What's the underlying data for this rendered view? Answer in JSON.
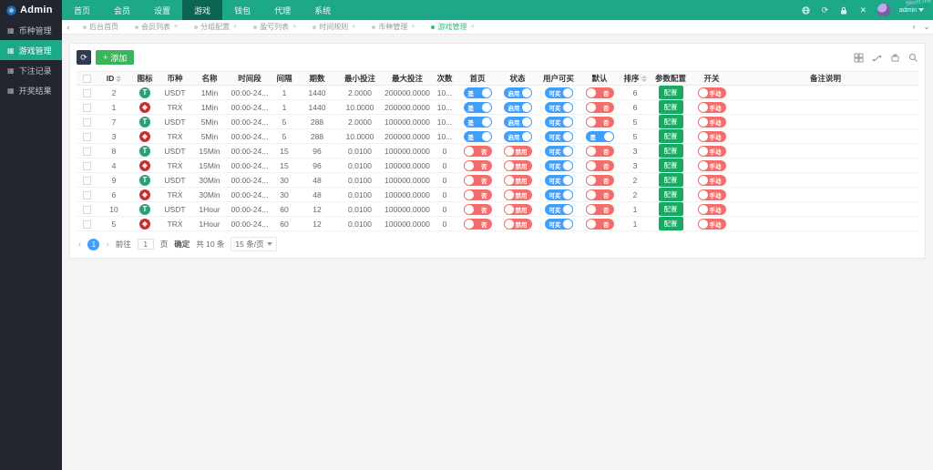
{
  "topbar": {
    "brand": "Admin",
    "nav": [
      {
        "label": "首页",
        "active": false
      },
      {
        "label": "会员",
        "active": false
      },
      {
        "label": "设置",
        "active": false
      },
      {
        "label": "游戏",
        "active": true
      },
      {
        "label": "钱包",
        "active": false
      },
      {
        "label": "代理",
        "active": false
      },
      {
        "label": "系统",
        "active": false
      }
    ],
    "icons": [
      "language-icon",
      "refresh-icon",
      "lock-icon",
      "fullscreen-icon"
    ],
    "user": "admin",
    "watermark": "9kvm.me"
  },
  "sidebar": {
    "items": [
      {
        "label": "币种管理",
        "active": false
      },
      {
        "label": "游戏管理",
        "active": true
      },
      {
        "label": "下注记录",
        "active": false
      },
      {
        "label": "开奖结果",
        "active": false
      }
    ]
  },
  "tabs": {
    "items": [
      {
        "label": "后台首页",
        "closable": false,
        "active": false
      },
      {
        "label": "会员列表",
        "closable": true,
        "active": false
      },
      {
        "label": "分组配置",
        "closable": true,
        "active": false
      },
      {
        "label": "盈亏列表",
        "closable": true,
        "active": false
      },
      {
        "label": "时间规则",
        "closable": true,
        "active": false
      },
      {
        "label": "币种管理",
        "closable": true,
        "active": false
      },
      {
        "label": "游戏管理",
        "closable": true,
        "active": true
      }
    ]
  },
  "toolbar": {
    "add_label": "添加"
  },
  "table": {
    "headers": [
      "ID",
      "图标",
      "币种",
      "名称",
      "时间段",
      "间隔",
      "期数",
      "最小投注",
      "最大投注",
      "次数",
      "首页",
      "状态",
      "用户可买",
      "默认",
      "排序",
      "参数配置",
      "开关",
      "备注说明"
    ],
    "config_label": "配置",
    "rows": [
      {
        "id": "2",
        "coin": "USDT",
        "name": "1Min",
        "time": "00:00-24...",
        "interval": "1",
        "periods": "1440",
        "min": "2.0000",
        "max": "200000.0000",
        "count": "10...",
        "home": {
          "on": true,
          "label": "是"
        },
        "status": {
          "on": true,
          "label": "启用"
        },
        "buyable": {
          "on": true,
          "label": "可买"
        },
        "dft": {
          "on": false,
          "label": "否"
        },
        "sort": "6",
        "switch": {
          "on": false,
          "label": "手动"
        }
      },
      {
        "id": "1",
        "coin": "TRX",
        "name": "1Min",
        "time": "00:00-24...",
        "interval": "1",
        "periods": "1440",
        "min": "10.0000",
        "max": "200000.0000",
        "count": "10...",
        "home": {
          "on": true,
          "label": "是"
        },
        "status": {
          "on": true,
          "label": "启用"
        },
        "buyable": {
          "on": true,
          "label": "可买"
        },
        "dft": {
          "on": false,
          "label": "否"
        },
        "sort": "6",
        "switch": {
          "on": false,
          "label": "手动"
        }
      },
      {
        "id": "7",
        "coin": "USDT",
        "name": "5Min",
        "time": "00:00-24...",
        "interval": "5",
        "periods": "288",
        "min": "2.0000",
        "max": "100000.0000",
        "count": "10...",
        "home": {
          "on": true,
          "label": "是"
        },
        "status": {
          "on": true,
          "label": "启用"
        },
        "buyable": {
          "on": true,
          "label": "可买"
        },
        "dft": {
          "on": false,
          "label": "否"
        },
        "sort": "5",
        "switch": {
          "on": false,
          "label": "手动"
        }
      },
      {
        "id": "3",
        "coin": "TRX",
        "name": "5Min",
        "time": "00:00-24...",
        "interval": "5",
        "periods": "288",
        "min": "10.0000",
        "max": "200000.0000",
        "count": "10...",
        "home": {
          "on": true,
          "label": "是"
        },
        "status": {
          "on": true,
          "label": "启用"
        },
        "buyable": {
          "on": true,
          "label": "可买"
        },
        "dft": {
          "on": true,
          "label": "是"
        },
        "sort": "5",
        "switch": {
          "on": false,
          "label": "手动"
        }
      },
      {
        "id": "8",
        "coin": "USDT",
        "name": "15Min",
        "time": "00:00-24...",
        "interval": "15",
        "periods": "96",
        "min": "0.0100",
        "max": "100000.0000",
        "count": "0",
        "home": {
          "on": false,
          "label": "否"
        },
        "status": {
          "on": false,
          "label": "禁用"
        },
        "buyable": {
          "on": true,
          "label": "可买"
        },
        "dft": {
          "on": false,
          "label": "否"
        },
        "sort": "3",
        "switch": {
          "on": false,
          "label": "手动"
        }
      },
      {
        "id": "4",
        "coin": "TRX",
        "name": "15Min",
        "time": "00:00-24...",
        "interval": "15",
        "periods": "96",
        "min": "0.0100",
        "max": "100000.0000",
        "count": "0",
        "home": {
          "on": false,
          "label": "否"
        },
        "status": {
          "on": false,
          "label": "禁用"
        },
        "buyable": {
          "on": true,
          "label": "可买"
        },
        "dft": {
          "on": false,
          "label": "否"
        },
        "sort": "3",
        "switch": {
          "on": false,
          "label": "手动"
        }
      },
      {
        "id": "9",
        "coin": "USDT",
        "name": "30Min",
        "time": "00:00-24...",
        "interval": "30",
        "periods": "48",
        "min": "0.0100",
        "max": "100000.0000",
        "count": "0",
        "home": {
          "on": false,
          "label": "否"
        },
        "status": {
          "on": false,
          "label": "禁用"
        },
        "buyable": {
          "on": true,
          "label": "可买"
        },
        "dft": {
          "on": false,
          "label": "否"
        },
        "sort": "2",
        "switch": {
          "on": false,
          "label": "手动"
        }
      },
      {
        "id": "6",
        "coin": "TRX",
        "name": "30Min",
        "time": "00:00-24...",
        "interval": "30",
        "periods": "48",
        "min": "0.0100",
        "max": "100000.0000",
        "count": "0",
        "home": {
          "on": false,
          "label": "否"
        },
        "status": {
          "on": false,
          "label": "禁用"
        },
        "buyable": {
          "on": true,
          "label": "可买"
        },
        "dft": {
          "on": false,
          "label": "否"
        },
        "sort": "2",
        "switch": {
          "on": false,
          "label": "手动"
        }
      },
      {
        "id": "10",
        "coin": "USDT",
        "name": "1Hour",
        "time": "00:00-24...",
        "interval": "60",
        "periods": "12",
        "min": "0.0100",
        "max": "100000.0000",
        "count": "0",
        "home": {
          "on": false,
          "label": "否"
        },
        "status": {
          "on": false,
          "label": "禁用"
        },
        "buyable": {
          "on": true,
          "label": "可买"
        },
        "dft": {
          "on": false,
          "label": "否"
        },
        "sort": "1",
        "switch": {
          "on": false,
          "label": "手动"
        }
      },
      {
        "id": "5",
        "coin": "TRX",
        "name": "1Hour",
        "time": "00:00-24...",
        "interval": "60",
        "periods": "12",
        "min": "0.0100",
        "max": "100000.0000",
        "count": "0",
        "home": {
          "on": false,
          "label": "否"
        },
        "status": {
          "on": false,
          "label": "禁用"
        },
        "buyable": {
          "on": true,
          "label": "可买"
        },
        "dft": {
          "on": false,
          "label": "否"
        },
        "sort": "1",
        "switch": {
          "on": false,
          "label": "手动"
        }
      }
    ]
  },
  "pagination": {
    "page": "1",
    "goto_label": "前往",
    "goto_value": "1",
    "page_suffix": "页",
    "confirm_label": "确定",
    "total_label": "共 10 条",
    "per_page_label": "15 条/页"
  }
}
